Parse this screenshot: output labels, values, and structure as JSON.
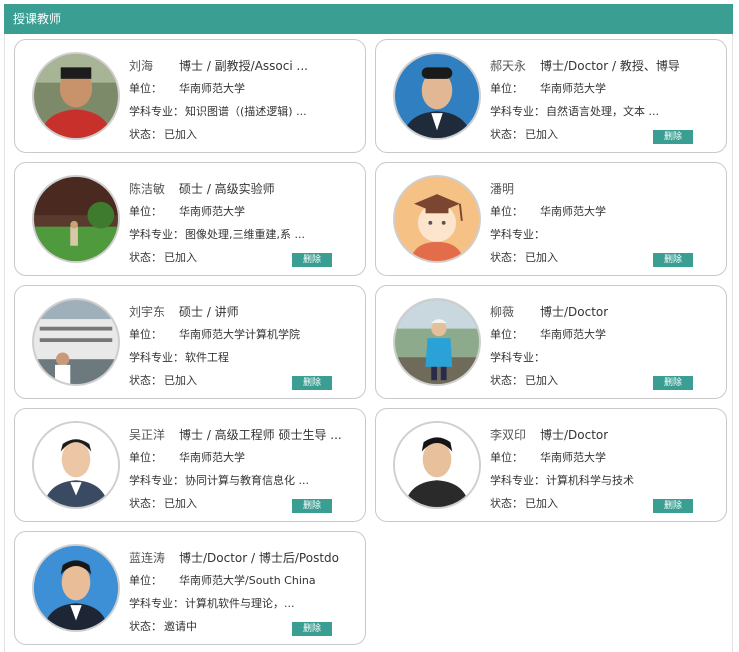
{
  "panel": {
    "title": "授课教师"
  },
  "labels": {
    "unit": "单位：",
    "major": "学科专业：",
    "status": "状态：",
    "delete": "删除"
  },
  "teachers": [
    {
      "name": "刘海",
      "title": "博士 / 副教授/Associ ...",
      "unit": "华南师范大学",
      "major": "知识图谱（(描述逻辑) ...",
      "status": "已加入",
      "avatar": "photo-man-red-shirt"
    },
    {
      "name": "郝天永",
      "title": "博士/Doctor / 教授、博导",
      "unit": "华南师范大学",
      "major": "自然语言处理，文本 ...",
      "status": "已加入",
      "avatar": "photo-man-suit-blue"
    },
    {
      "name": "陈洁敏",
      "title": "硕士 / 高级实验师",
      "unit": "华南师范大学",
      "major": "图像处理,三维重建,系 ...",
      "status": "已加入",
      "avatar": "photo-outdoor-park"
    },
    {
      "name": "潘明",
      "title": "",
      "unit": "华南师范大学",
      "major": "",
      "status": "已加入",
      "avatar": "graduate-cartoon-icon"
    },
    {
      "name": "刘宇东",
      "title": "硕士 / 讲师",
      "unit": "华南师范大学计算机学院",
      "major": "软件工程",
      "status": "已加入",
      "avatar": "photo-ship-building"
    },
    {
      "name": "柳薇",
      "title": "博士/Doctor",
      "unit": "华南师范大学",
      "major": "",
      "status": "已加入",
      "avatar": "photo-woman-outdoor"
    },
    {
      "name": "吴正洋",
      "title": "博士 / 高级工程师 硕士生导 ...",
      "unit": "华南师范大学",
      "major": "协同计算与教育信息化 ...",
      "status": "已加入",
      "avatar": "photo-man-white-bg"
    },
    {
      "name": "李双印",
      "title": "博士/Doctor",
      "unit": "华南师范大学",
      "major": "计算机科学与技术",
      "status": "已加入",
      "avatar": "photo-man-black-shirt"
    },
    {
      "name": "蓝连涛",
      "title": "博士/Doctor / 博士后/Postdo",
      "unit": "华南师范大学/South China",
      "major": "计算机软件与理论，...",
      "status": "邀请中",
      "avatar": "photo-man-blue-bg"
    }
  ]
}
